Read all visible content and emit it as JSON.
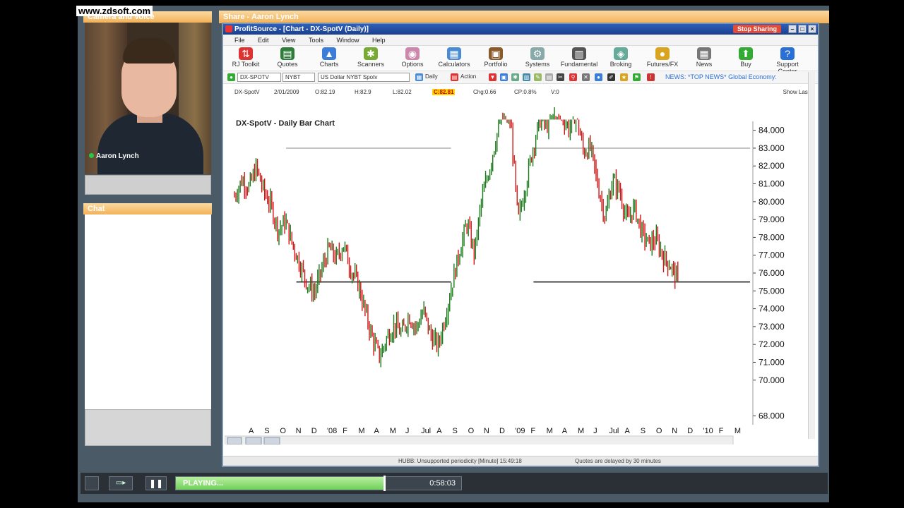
{
  "watermark": "www.zdsoft.com",
  "camera_panel": {
    "title": "Camera and Voice",
    "presenter_name": "Aaron Lynch"
  },
  "chat_panel": {
    "title": "Chat"
  },
  "share_window": {
    "title": "Share - Aaron Lynch"
  },
  "app": {
    "title": "ProfitSource - [Chart - DX-SpotV (Daily)]",
    "stop_sharing": "Stop Sharing",
    "menu": [
      "File",
      "Edit",
      "View",
      "Tools",
      "Window",
      "Help"
    ],
    "toolbar": [
      {
        "label": "RJ Toolkit",
        "icon": "arrows-icon",
        "color": "#d33"
      },
      {
        "label": "Quotes",
        "icon": "quotes-icon",
        "color": "#2f7d3a"
      },
      {
        "label": "Charts",
        "icon": "charts-icon",
        "color": "#3b7dd8"
      },
      {
        "label": "Scanners",
        "icon": "scanners-icon",
        "color": "#7a3"
      },
      {
        "label": "Options",
        "icon": "options-icon",
        "color": "#c8a"
      },
      {
        "label": "Calculators",
        "icon": "calculator-icon",
        "color": "#4a8bd6"
      },
      {
        "label": "Portfolio",
        "icon": "portfolio-icon",
        "color": "#8a5a2a"
      },
      {
        "label": "Systems",
        "icon": "systems-icon",
        "color": "#8aa"
      },
      {
        "label": "Fundamental",
        "icon": "fundamental-icon",
        "color": "#555"
      },
      {
        "label": "Broking",
        "icon": "broking-icon",
        "color": "#6a9"
      },
      {
        "label": "Futures/FX",
        "icon": "coins-icon",
        "color": "#d9a520"
      },
      {
        "label": "News",
        "icon": "news-icon",
        "color": "#777"
      },
      {
        "label": "Buy",
        "icon": "buy-icon",
        "color": "#3a3"
      },
      {
        "label": "Support Center",
        "icon": "help-icon",
        "color": "#2a6fd6"
      }
    ],
    "symbol_field": "DX-SPOTV",
    "exchange_field": "NYBT",
    "description_field": "US Dollar NYBT Spotv",
    "period_label": "Daily",
    "action_label": "Action",
    "news_ticker": "NEWS: *TOP NEWS* Global Economy:",
    "quote": {
      "symbol": "DX-SpotV",
      "date": "2/01/2009",
      "open": "O:82.19",
      "high": "H:82.9",
      "low": "L:82.02",
      "close": "C:82.81",
      "change": "Chg:0.66",
      "change_pct": "CP:0.8%",
      "volume": "V:0"
    },
    "show_last": "Show Last",
    "status_left": "HUBB: Unsupported periodicity [Minute] 15:49:18",
    "status_right": "Quotes are delayed by 30 minutes"
  },
  "chart_data": {
    "type": "bar",
    "title": "DX-SpotV - Daily Bar Chart",
    "y_ticks": [
      "84.000",
      "83.000",
      "82.000",
      "81.000",
      "80.000",
      "79.000",
      "78.000",
      "77.000",
      "76.000",
      "75.000",
      "74.000",
      "73.000",
      "72.000",
      "71.000",
      "70.000",
      "68.000"
    ],
    "ylim": [
      67.5,
      84.5
    ],
    "x_ticks": [
      "A",
      "S",
      "O",
      "N",
      "D",
      "'08",
      "F",
      "M",
      "A",
      "M",
      "J",
      "Jul",
      "A",
      "S",
      "O",
      "N",
      "D",
      "'09",
      "F",
      "M",
      "A",
      "M",
      "J",
      "Jul",
      "A",
      "S",
      "O",
      "N",
      "D",
      "'10",
      "F",
      "M"
    ],
    "resistance_levels": [
      {
        "value": 83.0,
        "segments": [
          [
            0.1,
            0.42
          ],
          [
            0.58,
            1.0
          ]
        ]
      }
    ],
    "support_levels": [
      {
        "value": 75.5,
        "segments": [
          [
            0.12,
            0.42
          ],
          [
            0.58,
            1.0
          ]
        ]
      }
    ],
    "price_path": [
      80.3,
      81.2,
      80.8,
      81.9,
      80.6,
      79.8,
      78.4,
      78.9,
      77.6,
      76.5,
      75.4,
      74.9,
      76.2,
      77.4,
      76.8,
      77.6,
      76.2,
      75.4,
      73.8,
      72.3,
      71.3,
      72.4,
      73.1,
      72.6,
      73.6,
      72.9,
      73.9,
      72.5,
      71.9,
      73.6,
      75.5,
      77.3,
      78.8,
      77.1,
      80.1,
      81.7,
      83.6,
      85.2,
      84.5,
      78.9,
      80.8,
      82.9,
      84.6,
      84.3,
      85.6,
      84.9,
      84.1,
      85.0,
      82.8,
      83.0,
      80.9,
      79.1,
      81.2,
      80.6,
      78.9,
      79.7,
      78.3,
      77.6,
      77.9,
      76.9,
      76.4,
      75.6
    ]
  },
  "player": {
    "status": "PLAYING...",
    "time": "0:58:03",
    "progress": 0.73
  }
}
